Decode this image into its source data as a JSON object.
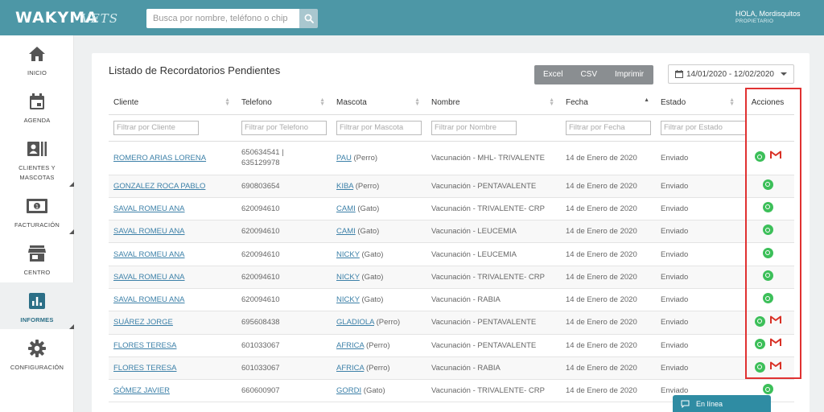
{
  "app": {
    "logo": "WAKYMA",
    "logo_sub": "VETS"
  },
  "search": {
    "placeholder": "Busca por nombre, teléfono o chip"
  },
  "user": {
    "greeting": "HOLA, Mordisquitos",
    "role": "PROPIETARIO"
  },
  "sidebar": {
    "items": [
      {
        "label": "INICIO",
        "icon": "home-icon"
      },
      {
        "label": "AGENDA",
        "icon": "calendar-icon"
      },
      {
        "label": "CLIENTES Y MASCOTAS",
        "icon": "contact-card-icon"
      },
      {
        "label": "FACTURACIÓN",
        "icon": "banknote-icon"
      },
      {
        "label": "CENTRO",
        "icon": "store-icon"
      },
      {
        "label": "INFORMES",
        "icon": "report-chart-icon",
        "active": true
      },
      {
        "label": "CONFIGURACIÓN",
        "icon": "gear-icon"
      }
    ]
  },
  "page": {
    "title": "Listado de Recordatorios Pendientes",
    "export": {
      "excel": "Excel",
      "csv": "CSV",
      "print": "Imprimir"
    },
    "date_range": "14/01/2020 - 12/02/2020"
  },
  "table": {
    "headers": [
      "Cliente",
      "Telefono",
      "Mascota",
      "Nombre",
      "Fecha",
      "Estado",
      "Acciones"
    ],
    "filters": [
      "Filtrar por Cliente",
      "Filtrar por Telefono",
      "Filtrar por Mascota",
      "Filtrar por Nombre",
      "Filtrar por Fecha",
      "Filtrar por Estado"
    ],
    "rows": [
      {
        "client": "ROMERO ARIAS LORENA",
        "phone": "650634541 |",
        "phone2": "635129978",
        "pet": "PAU",
        "pet_type": "(Perro)",
        "name": "Vacunación - MHL- TRIVALENTE",
        "date": "14 de Enero de 2020",
        "status": "Enviado",
        "gmail": true
      },
      {
        "client": "GONZALEZ ROCA PABLO",
        "phone": "690803654",
        "pet": "KIBA",
        "pet_type": "(Perro)",
        "name": "Vacunación - PENTAVALENTE",
        "date": "14 de Enero de 2020",
        "status": "Enviado",
        "gmail": false
      },
      {
        "client": "SAVAL ROMEU ANA",
        "phone": "620094610",
        "pet": "CAMI",
        "pet_type": "(Gato)",
        "name": "Vacunación - TRIVALENTE- CRP",
        "date": "14 de Enero de 2020",
        "status": "Enviado",
        "gmail": false
      },
      {
        "client": "SAVAL ROMEU ANA",
        "phone": "620094610",
        "pet": "CAMI",
        "pet_type": "(Gato)",
        "name": "Vacunación - LEUCEMIA",
        "date": "14 de Enero de 2020",
        "status": "Enviado",
        "gmail": false
      },
      {
        "client": "SAVAL ROMEU ANA",
        "phone": "620094610",
        "pet": "NICKY",
        "pet_type": "(Gato)",
        "name": "Vacunación - LEUCEMIA",
        "date": "14 de Enero de 2020",
        "status": "Enviado",
        "gmail": false
      },
      {
        "client": "SAVAL ROMEU ANA",
        "phone": "620094610",
        "pet": "NICKY",
        "pet_type": "(Gato)",
        "name": "Vacunación - TRIVALENTE- CRP",
        "date": "14 de Enero de 2020",
        "status": "Enviado",
        "gmail": false
      },
      {
        "client": "SAVAL ROMEU ANA",
        "phone": "620094610",
        "pet": "NICKY",
        "pet_type": "(Gato)",
        "name": "Vacunación - RABIA",
        "date": "14 de Enero de 2020",
        "status": "Enviado",
        "gmail": false
      },
      {
        "client": "SUÁREZ JORGE",
        "phone": "695608438",
        "pet": "GLADIOLA",
        "pet_type": "(Perro)",
        "name": "Vacunación - PENTAVALENTE",
        "date": "14 de Enero de 2020",
        "status": "Enviado",
        "gmail": true
      },
      {
        "client": "FLORES TERESA",
        "phone": "601033067",
        "pet": "AFRICA",
        "pet_type": "(Perro)",
        "name": "Vacunación - PENTAVALENTE",
        "date": "14 de Enero de 2020",
        "status": "Enviado",
        "gmail": true
      },
      {
        "client": "FLORES TERESA",
        "phone": "601033067",
        "pet": "AFRICA",
        "pet_type": "(Perro)",
        "name": "Vacunación - RABIA",
        "date": "14 de Enero de 2020",
        "status": "Enviado",
        "gmail": true
      },
      {
        "client": "GÓMEZ JAVIER",
        "phone": "660600907",
        "pet": "GORDI",
        "pet_type": "(Gato)",
        "name": "Vacunación - TRIVALENTE- CRP",
        "date": "14 de Enero de 2020",
        "status": "Enviado",
        "gmail": false
      }
    ]
  },
  "chat": {
    "label": "En línea"
  },
  "colors": {
    "topbar": "#4d97a6",
    "whatsapp": "#3cbf59",
    "gmail": "#d93025",
    "link": "#3c80a8",
    "highlight": "#e03131"
  }
}
